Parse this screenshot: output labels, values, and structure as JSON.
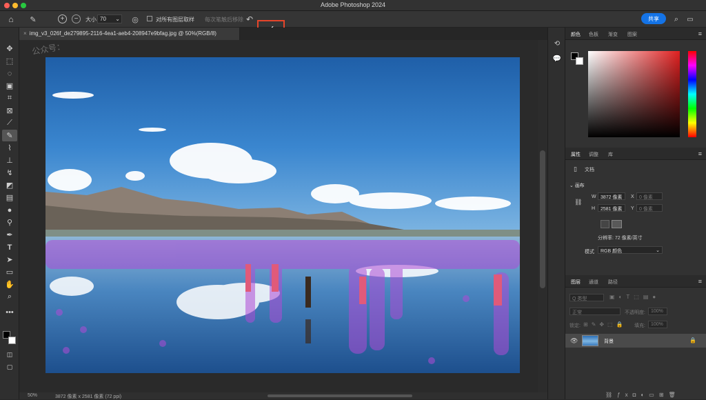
{
  "app": {
    "title": "Adobe Photoshop 2024"
  },
  "options": {
    "size_label": "大小",
    "size_value": "70",
    "sample_all_label": "对所有图层取样",
    "enhance_label": "每次笔触后移除",
    "share_label": "共享"
  },
  "document": {
    "tab_title": "img_v3_026f_de279895-2116-4ea1-aeb4-208947e9bfag.jpg @ 50%(RGB/8)",
    "watermark": "公众号：",
    "zoom": "50%",
    "status_info": "3872 像素 x 2581 像素 (72 ppi)"
  },
  "color_panel": {
    "tabs": [
      "颜色",
      "色板",
      "渐变",
      "图案"
    ]
  },
  "properties_panel": {
    "tabs": [
      "属性",
      "调整",
      "库"
    ],
    "doc_label": "文档",
    "canvas_section": "画布",
    "w_label": "W",
    "w_value": "3872 像素",
    "h_label": "H",
    "h_value": "2581 像素",
    "x_label": "X",
    "x_value": "0 像素",
    "y_label": "Y",
    "y_value": "0 像素",
    "resolution": "分辨率: 72 像素/英寸",
    "mode_label": "模式",
    "mode_value": "RGB 颜色"
  },
  "layers_panel": {
    "tabs": [
      "图层",
      "通道",
      "路径"
    ],
    "filter_label": "Q 类型",
    "blend_mode": "正常",
    "opacity_label": "不透明度:",
    "opacity_value": "100%",
    "lock_label": "锁定:",
    "fill_label": "填充:",
    "fill_value": "100%",
    "layer_name": "背景"
  },
  "colors": {
    "accent": "#1473e6",
    "highlight_box": "#e8452a",
    "mask": "#b04bd6"
  }
}
